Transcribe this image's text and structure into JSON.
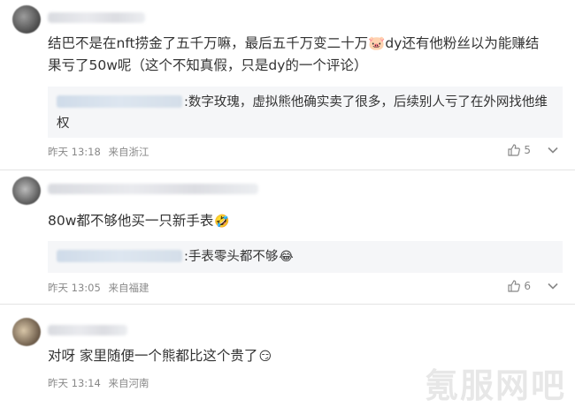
{
  "comments": [
    {
      "text": "结巴不是在nft捞金了五千万嘛，最后五千万变二十万🐷dy还有他粉丝以为能赚结果亏了50w呢（这个不知真假，只是dy的一个评论）",
      "reply": ":数字玫瑰，虚拟熊他确实卖了很多，后续别人亏了在外网找他维权",
      "time": "昨天 13:18",
      "location": "来自浙江",
      "likes": "5"
    },
    {
      "text": "80w都不够他买一只新手表",
      "emoji": "🤣",
      "reply": ":手表零头都不够",
      "reply_emoji": "😂",
      "time": "昨天 13:05",
      "location": "来自福建",
      "likes": "6"
    },
    {
      "text": "对呀 家里随便一个熊都比这个贵了",
      "emoji": "😏",
      "time": "昨天 13:14",
      "location": "来自河南"
    }
  ],
  "watermark": "氪服网吧",
  "icons": {
    "like": "thumbs-up-icon",
    "more": "chevron-down-icon"
  }
}
